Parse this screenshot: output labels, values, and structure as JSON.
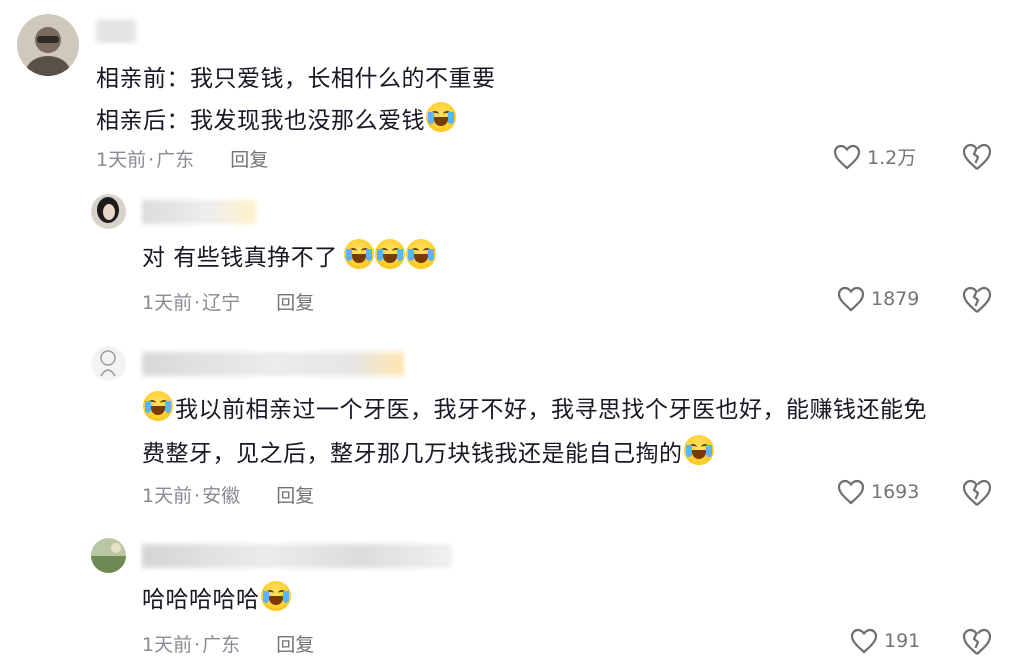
{
  "comments": [
    {
      "lines": [
        "相亲前：我只爱钱，长相什么的不重要",
        "相亲后：我发现我也没那么爱钱"
      ],
      "emoji_count": 1,
      "meta": {
        "time": "1天前",
        "location": "广东",
        "reply": "回复"
      },
      "likes": "1.2万"
    },
    {
      "lines": [
        "对 有些钱真挣不了"
      ],
      "emoji_count": 3,
      "meta": {
        "time": "1天前",
        "location": "辽宁",
        "reply": "回复"
      },
      "likes": "1879"
    },
    {
      "lines": [
        "我以前相亲过一个牙医，我牙不好，我寻思找个牙医也好，能赚钱还能免",
        "费整牙，见之后，整牙那几万块钱我还是能自己掏的"
      ],
      "emoji_count": 1,
      "meta": {
        "time": "1天前",
        "location": "安徽",
        "reply": "回复"
      },
      "likes": "1693"
    },
    {
      "lines": [
        "哈哈哈哈哈"
      ],
      "emoji_count": 1,
      "meta": {
        "time": "1天前",
        "location": "广东",
        "reply": "回复"
      },
      "likes": "191"
    }
  ],
  "emoji_name": "laughing-crying-emoji",
  "colors": {
    "text": "#161823",
    "meta": "#8a8b91",
    "background": "#ffffff"
  }
}
